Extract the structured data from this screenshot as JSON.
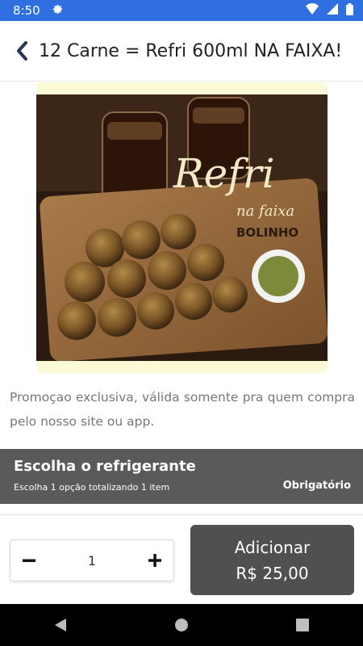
{
  "status_bar": {
    "time": "8:50",
    "icons": [
      "gear-icon",
      "wifi-icon",
      "signal-icon",
      "battery-icon"
    ]
  },
  "header": {
    "back_icon": "chevron-left-icon",
    "title": "12 Carne = Refri 600ml NA FAIXA!"
  },
  "product_image": {
    "logo_text": "Refri",
    "logo_sub": "na faixa",
    "brand": "BOLINHO",
    "colors": {
      "background": "#fbfad7"
    }
  },
  "description": "Promoçao exclusiva, válida somente pra quem compra pelo nosso site ou app.",
  "option_section": {
    "title": "Escolha o refrigerante",
    "subtitle": "Escolha 1 opção totalizando 1 item",
    "badge": "Obrigatório"
  },
  "footer": {
    "quantity": "1",
    "minus_icon": "minus-icon",
    "plus_icon": "plus-icon",
    "add_label": "Adicionar",
    "price": "R$ 25,00"
  },
  "nav_bar": {
    "icons": [
      "back-triangle-icon",
      "home-circle-icon",
      "recents-square-icon"
    ]
  },
  "colors": {
    "status_bar": "#2f6fe0",
    "section_bg": "#5a5a5a",
    "add_button": "#505050"
  }
}
